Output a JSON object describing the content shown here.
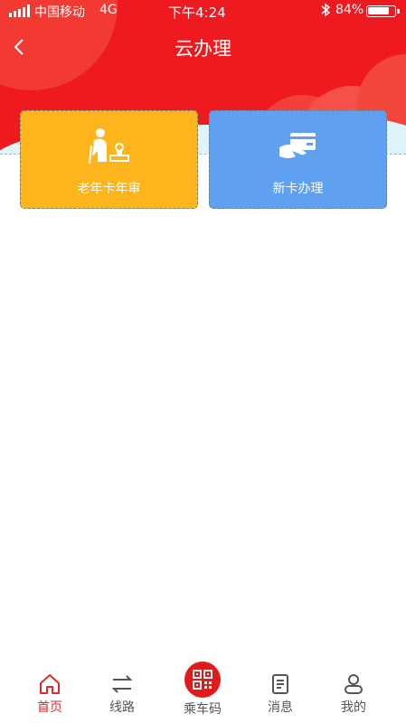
{
  "status_bar": {
    "carrier": "中国移动",
    "network": "4G",
    "time": "下午4:24",
    "battery_percent": "84%",
    "battery_level": 0.84
  },
  "header": {
    "title": "云办理",
    "back_icon": "chevron-left-icon"
  },
  "cards": [
    {
      "label": "老年卡年审",
      "icon": "elderly-stamp-icon",
      "color": "#fdb51b"
    },
    {
      "label": "新卡办理",
      "icon": "hand-card-icon",
      "color": "#60a0f0"
    }
  ],
  "tabbar": {
    "items": [
      {
        "label": "首页",
        "icon": "home-icon",
        "active": true
      },
      {
        "label": "线路",
        "icon": "route-arrows-icon",
        "active": false
      },
      {
        "label": "乘车码",
        "icon": "qr-code-icon",
        "active": false
      },
      {
        "label": "消息",
        "icon": "message-icon",
        "active": false
      },
      {
        "label": "我的",
        "icon": "user-icon",
        "active": false
      }
    ],
    "active_color": "#e52a2a"
  },
  "colors": {
    "header_red": "#ee1a1f",
    "wave": "#dff3fb"
  }
}
